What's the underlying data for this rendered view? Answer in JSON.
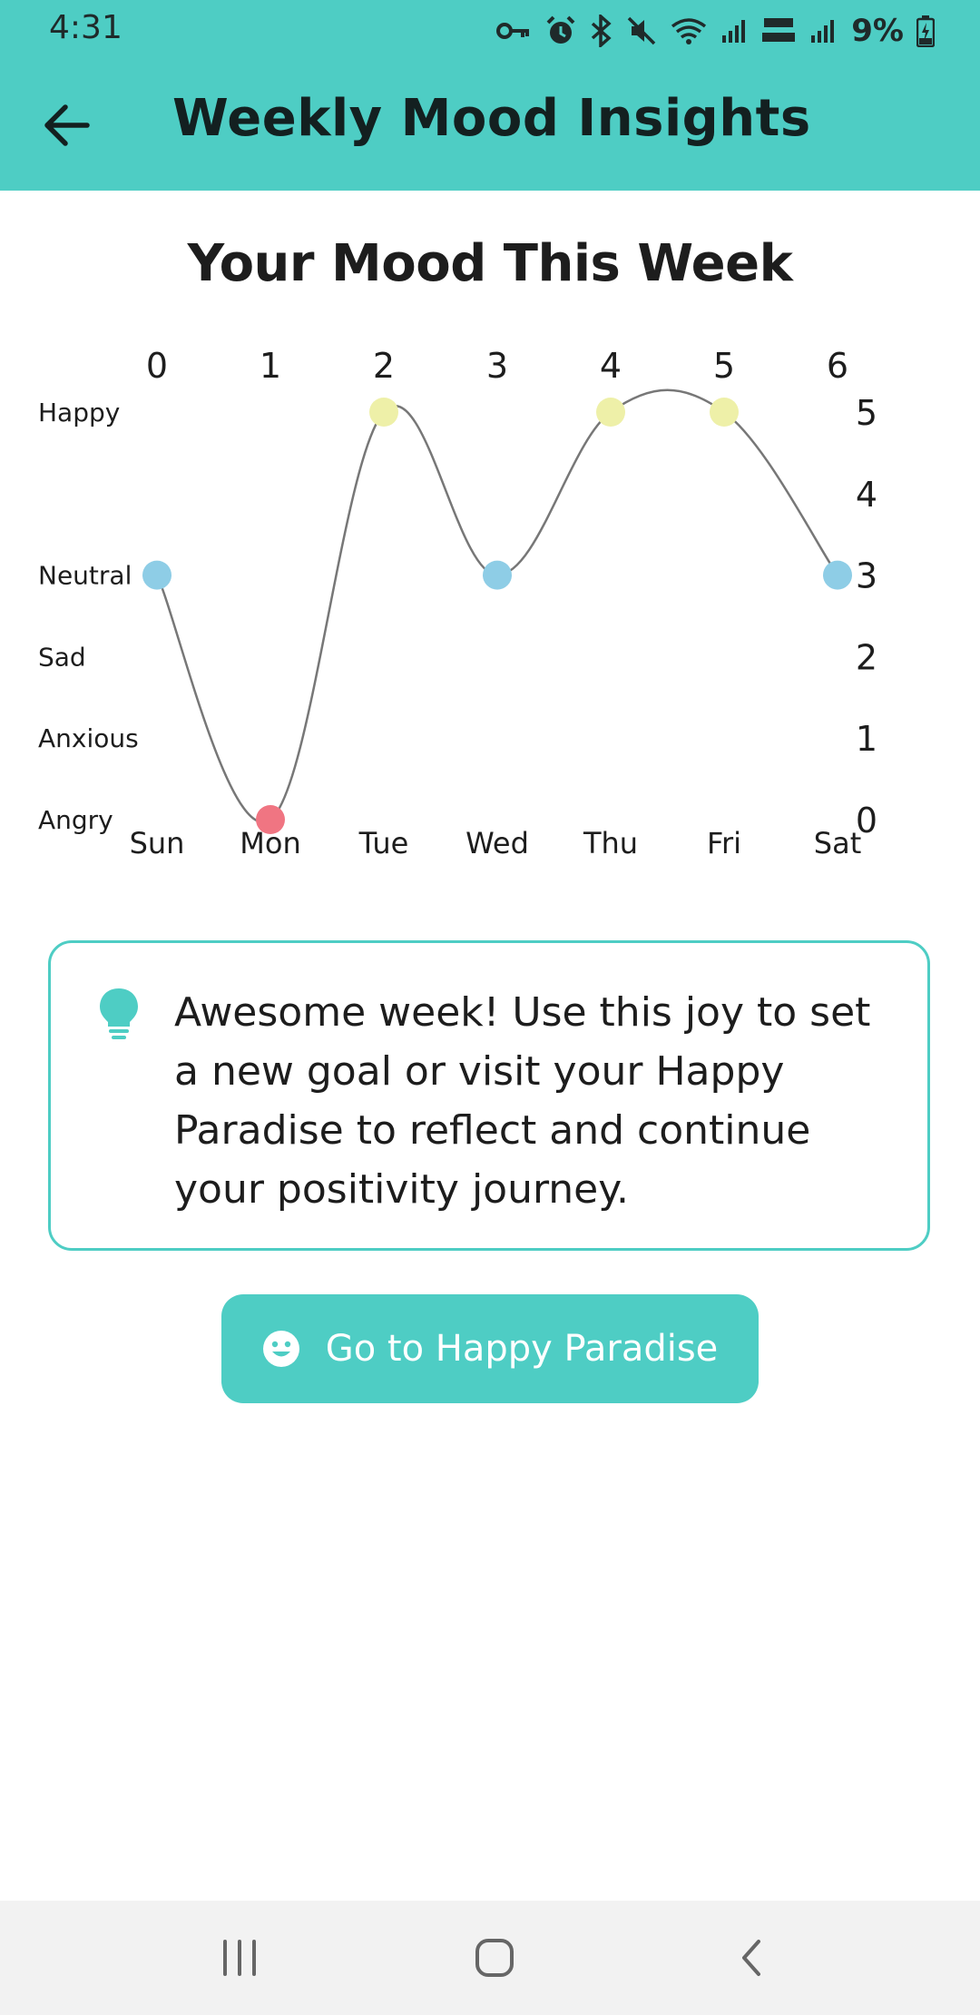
{
  "status_bar": {
    "time": "4:31",
    "battery": "9%"
  },
  "app_bar": {
    "title": "Weekly Mood Insights"
  },
  "chart_title": "Your Mood This Week",
  "chart_data": {
    "type": "line",
    "categories": [
      "Sun",
      "Mon",
      "Tue",
      "Wed",
      "Thu",
      "Fri",
      "Sat"
    ],
    "x_top_ticks": [
      "0",
      "1",
      "2",
      "3",
      "4",
      "5",
      "6"
    ],
    "values": [
      3,
      0,
      5,
      3,
      5,
      5,
      3
    ],
    "ylim": [
      0,
      5
    ],
    "y_right_ticks": [
      "0",
      "1",
      "2",
      "3",
      "4",
      "5"
    ],
    "mood_labels": [
      {
        "label": "Angry",
        "value": 0
      },
      {
        "label": "Anxious",
        "value": 1
      },
      {
        "label": "Sad",
        "value": 2
      },
      {
        "label": "Neutral",
        "value": 3
      },
      {
        "label": "Happy",
        "value": 5
      }
    ],
    "point_colors": {
      "0": "#f07582",
      "3": "#8ecde6",
      "5": "#eef0a8"
    },
    "line_color": "#777777",
    "grid": false,
    "legend": false
  },
  "tip": {
    "icon": "lightbulb-icon",
    "text": "Awesome week! Use this joy to set a new goal or visit your Happy Paradise to reflect and continue your positivity journey."
  },
  "cta": {
    "label": "Go to Happy Paradise",
    "icon": "smiley-icon"
  },
  "colors": {
    "accent": "#4ecdc4"
  }
}
